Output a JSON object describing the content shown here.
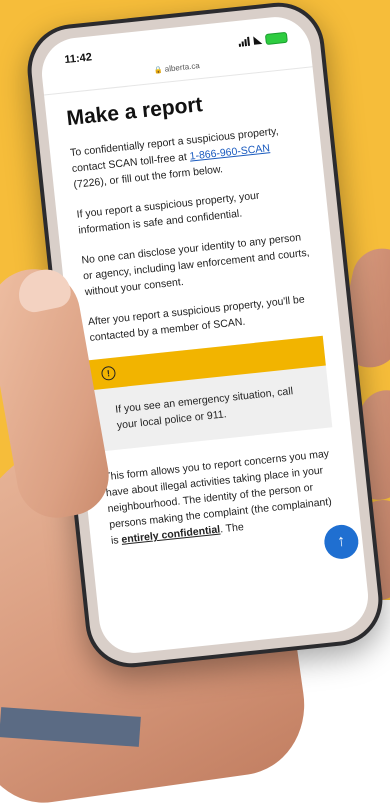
{
  "status_bar": {
    "time": "11:42",
    "wifi_icon": "wifi-icon",
    "battery_icon": "battery-icon"
  },
  "browser": {
    "url": "alberta.ca",
    "lock_icon": "lock-icon"
  },
  "page": {
    "title": "Make a report",
    "intro_before_link": "To confidentially report a suspicious property, contact SCAN toll-free at ",
    "phone_link": "1-866-960-SCAN",
    "intro_after_link": " (7226), or fill out the form below.",
    "para_safe": "If you report a suspicious property, your information is safe and confidential.",
    "para_disclose": "No one can disclose your identity to any person or agency, including law enforcement and courts, without your consent.",
    "para_contacted": "After you report a suspicious property, you'll be contacted by a member of SCAN.",
    "alert": {
      "icon": "info-icon",
      "text": "If you see an emergency situation, call your local police or 911."
    },
    "form_intro_start": "This form allows you to report concerns you may have about illegal activities taking place in your neighbourhood. The identity of the person or persons making the complaint (the complainant) ",
    "form_intro_is": "is ",
    "form_intro_bold": "entirely confidential",
    "form_intro_end": ". The",
    "scroll_top_icon": "arrow-up-icon"
  },
  "colors": {
    "background_yellow": "#f6bd3a",
    "alert_yellow": "#f2b400",
    "link_blue": "#1a5bbf",
    "scroll_button_blue": "#1f6fd1"
  }
}
